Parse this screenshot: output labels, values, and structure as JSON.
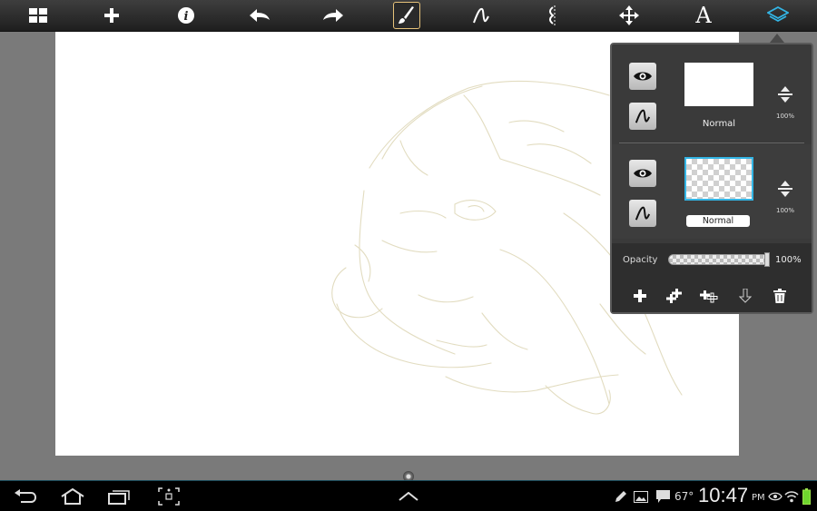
{
  "toolbar": {
    "items": [
      {
        "name": "gallery-grid-icon"
      },
      {
        "name": "add-icon"
      },
      {
        "name": "info-icon"
      },
      {
        "name": "undo-icon"
      },
      {
        "name": "redo-icon"
      },
      {
        "name": "brush-icon",
        "active": true
      },
      {
        "name": "stroke-icon"
      },
      {
        "name": "symmetry-icon"
      },
      {
        "name": "move-icon"
      },
      {
        "name": "text-icon",
        "glyph": "A"
      },
      {
        "name": "layers-icon",
        "active": true
      }
    ],
    "accent": "#33b5e5",
    "active_border": "#e6c27a"
  },
  "layers": {
    "items": [
      {
        "blend_mode": "Normal",
        "opacity_label": "100%",
        "selected": false
      },
      {
        "blend_mode": "Normal",
        "opacity_label": "100%",
        "selected": true
      }
    ],
    "opacity_label": "Opacity",
    "opacity_value": "100%",
    "opacity_fraction": 1.0,
    "actions": [
      "add-layer-icon",
      "duplicate-layer-icon",
      "merge-layer-icon",
      "move-down-icon",
      "trash-icon"
    ]
  },
  "system_bar": {
    "temperature": "67°",
    "time": "10:47",
    "ampm": "PM"
  }
}
